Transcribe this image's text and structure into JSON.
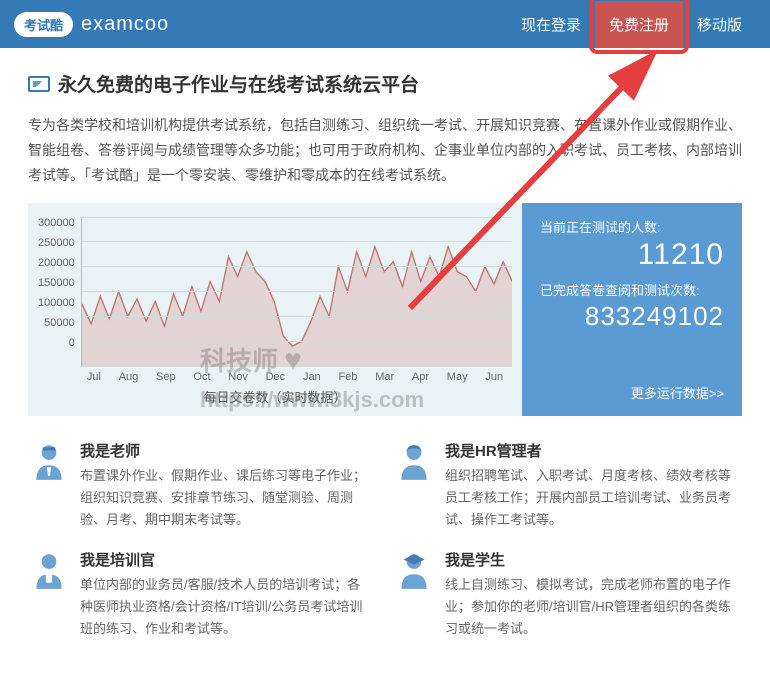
{
  "header": {
    "logo_badge": "考试酷",
    "brand": "examcoo",
    "nav_login": "现在登录",
    "nav_register": "免费注册",
    "nav_mobile": "移动版"
  },
  "page": {
    "title": "永久免费的电子作业与在线考试系统云平台",
    "intro": "专为各类学校和培训机构提供考试系统，包括自测练习、组织统一考试、开展知识竞赛、布置课外作业或假期作业、智能组卷、答卷评阅与成绩管理等众多功能；也可用于政府机构、企事业单位内部的入职考试、员工考核、内部培训考试等。「考试酷」是一个零安装、零维护和零成本的在线考试系统。"
  },
  "chart_data": {
    "type": "line",
    "title": "每日交卷数（实时数据）",
    "ylabel": "",
    "xlabel": "",
    "ylim": [
      0,
      300000
    ],
    "yticks": [
      0,
      50000,
      100000,
      150000,
      200000,
      250000,
      300000
    ],
    "categories": [
      "Jul",
      "Aug",
      "Sep",
      "Oct",
      "Nov",
      "Dec",
      "Jan",
      "Feb",
      "Mar",
      "Apr",
      "May",
      "Jun"
    ],
    "values": [
      125000,
      85000,
      140000,
      95000,
      150000,
      100000,
      135000,
      90000,
      130000,
      80000,
      145000,
      100000,
      160000,
      110000,
      170000,
      130000,
      220000,
      180000,
      230000,
      190000,
      170000,
      130000,
      60000,
      40000,
      50000,
      90000,
      140000,
      100000,
      200000,
      150000,
      230000,
      180000,
      240000,
      190000,
      210000,
      160000,
      230000,
      170000,
      220000,
      180000,
      240000,
      190000,
      180000,
      150000,
      200000,
      165000,
      210000,
      170000
    ]
  },
  "stats": {
    "testing_label": "当前正在测试的人数:",
    "testing_value": "11210",
    "completed_label": "已完成答卷查阅和测试次数:",
    "completed_value": "833249102",
    "more_link": "更多运行数据>>"
  },
  "roles": [
    {
      "title": "我是老师",
      "desc": "布置课外作业、假期作业、课后练习等电子作业；组织知识竞赛、安排章节练习、随堂测验、周测验、月考、期中期末考试等。"
    },
    {
      "title": "我是HR管理者",
      "desc": "组织招聘笔试、入职考试、月度考核、绩效考核等员工考核工作；开展内部员工培训考试、业务员考试、操作工考试等。"
    },
    {
      "title": "我是培训官",
      "desc": "单位内部的业务员/客服/技术人员的培训考试；各种医师执业资格/会计资格/IT培训/公务员考试培训班的练习、作业和考试等。"
    },
    {
      "title": "我是学生",
      "desc": "线上自测练习、模拟考试，完成老师布置的电子作业；参加你的老师/培训官/HR管理者组织的各类练习或统一考试。"
    }
  ],
  "watermark": {
    "title": "科技师",
    "url": "https://www.3kjs.com"
  }
}
